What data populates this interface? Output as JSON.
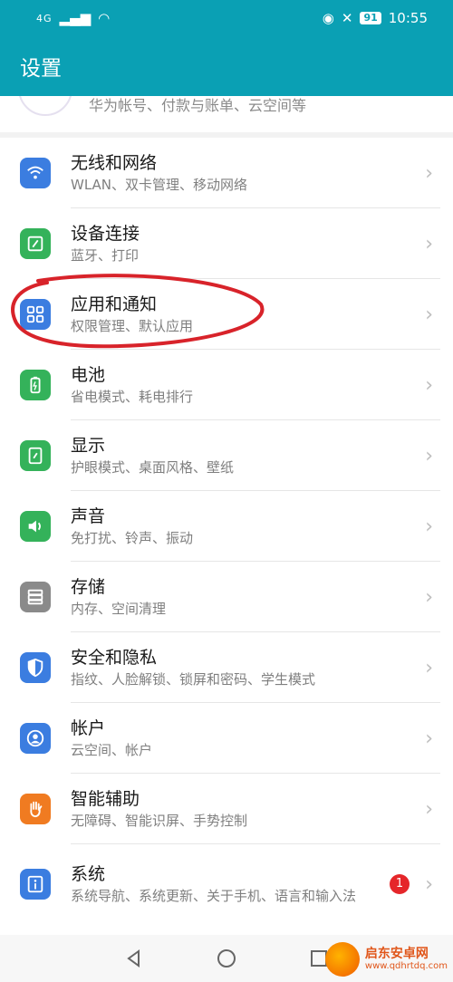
{
  "status_bar": {
    "network": "4G",
    "battery": "91",
    "time": "10:55"
  },
  "header": {
    "title": "设置"
  },
  "account": {
    "subtitle": "华为帐号、付款与账单、云空间等"
  },
  "items": [
    {
      "title": "无线和网络",
      "subtitle": "WLAN、双卡管理、移动网络",
      "icon": "wifi-icon",
      "color": "#3b7de0"
    },
    {
      "title": "设备连接",
      "subtitle": "蓝牙、打印",
      "icon": "device-link-icon",
      "color": "#34b25a"
    },
    {
      "title": "应用和通知",
      "subtitle": "权限管理、默认应用",
      "icon": "apps-grid-icon",
      "color": "#3b7de0"
    },
    {
      "title": "电池",
      "subtitle": "省电模式、耗电排行",
      "icon": "battery-icon",
      "color": "#34b25a"
    },
    {
      "title": "显示",
      "subtitle": "护眼模式、桌面风格、壁纸",
      "icon": "display-icon",
      "color": "#34b25a"
    },
    {
      "title": "声音",
      "subtitle": "免打扰、铃声、振动",
      "icon": "speaker-icon",
      "color": "#34b25a"
    },
    {
      "title": "存储",
      "subtitle": "内存、空间清理",
      "icon": "storage-icon",
      "color": "#8a8a8a"
    },
    {
      "title": "安全和隐私",
      "subtitle": "指纹、人脸解锁、锁屏和密码、学生模式",
      "icon": "shield-icon",
      "color": "#3b7de0"
    },
    {
      "title": "帐户",
      "subtitle": "云空间、帐户",
      "icon": "account-icon",
      "color": "#3b7de0"
    },
    {
      "title": "智能辅助",
      "subtitle": "无障碍、智能识屏、手势控制",
      "icon": "hand-icon",
      "color": "#f07b21"
    },
    {
      "title": "系统",
      "subtitle": "系统导航、系统更新、关于手机、语言和输入法",
      "icon": "info-icon",
      "color": "#3b7de0",
      "badge": "1"
    }
  ],
  "annotation_color": "#d8232a",
  "watermark": {
    "name": "启东安卓网",
    "url": "www.qdhrtdq.com"
  }
}
